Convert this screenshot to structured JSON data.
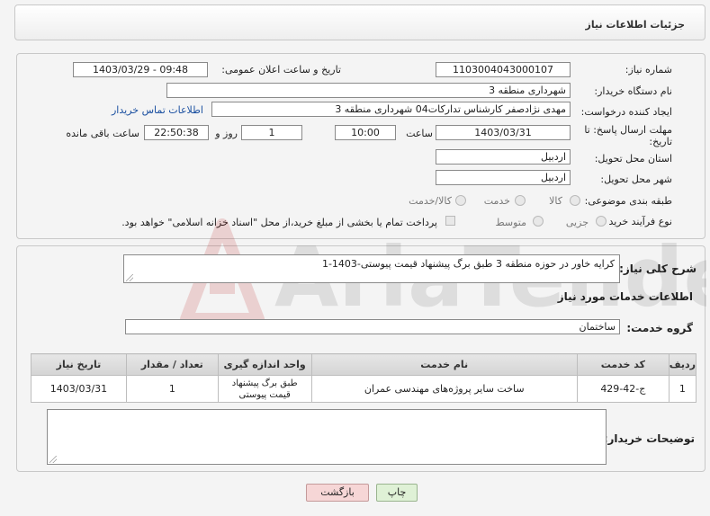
{
  "header": {
    "title": "جزئیات اطلاعات نیاز"
  },
  "form": {
    "need_number_label": "شماره نیاز:",
    "need_number": "1103004043000107",
    "announce_label": "تاریخ و ساعت اعلان عمومی:",
    "announce_value": "1403/03/29 - 09:48",
    "buyer_label": "نام دستگاه خریدار:",
    "buyer_value": "شهرداری منطقه 3",
    "creator_label": "ایجاد کننده درخواست:",
    "creator_value": "مهدی نژادصفر کارشناس تدارکات04 شهرداری منطقه 3",
    "contact_link": "اطلاعات تماس خریدار",
    "deadline_label_line1": "مهلت ارسال پاسخ: تا",
    "deadline_label_line2": "تاریخ:",
    "deadline_date": "1403/03/31",
    "time_label": "ساعت",
    "deadline_time": "10:00",
    "days_value": "1",
    "days_label": "روز و",
    "remaining_time": "22:50:38",
    "remaining_label": "ساعت باقی مانده",
    "province_label": "استان محل تحویل:",
    "province_value": "اردبیل",
    "city_label": "شهر محل تحویل:",
    "city_value": "اردبیل",
    "category_label": "طبقه بندی موضوعی:",
    "category_options": [
      "کالا",
      "خدمت",
      "کالا/خدمت"
    ],
    "process_label": "نوع فرآیند خرید :",
    "process_options": [
      "جزیی",
      "متوسط"
    ],
    "payment_note": "پرداخت تمام یا بخشی از مبلغ خرید،از محل \"اسناد خزانه اسلامی\" خواهد بود."
  },
  "details": {
    "summary_label": "شرح کلی نیاز:",
    "summary_value": "کرایه خاور در حوزه منطقه 3 طبق برگ پیشنهاد قیمت پیوستی-1403-1",
    "services_heading": "اطلاعات خدمات مورد نیاز",
    "service_group_label": "گروه خدمت:",
    "service_group_value": "ساختمان",
    "table": {
      "headers": [
        "ردیف",
        "کد خدمت",
        "نام خدمت",
        "واحد اندازه گیری",
        "تعداد / مقدار",
        "تاریخ نیاز"
      ],
      "rows": [
        [
          "1",
          "ج-42-429",
          "ساخت سایر پروژه‌های مهندسی عمران",
          "طبق برگ پیشنهاد قیمت پیوستی",
          "1",
          "1403/03/31"
        ]
      ]
    },
    "buyer_notes_label": "توضیحات خریدار:"
  },
  "buttons": {
    "print": "چاپ",
    "back": "بازگشت"
  },
  "watermark": {
    "text": "AriaTender.net"
  },
  "colors": {
    "link": "#1a4fa0",
    "back_button": "#f6d6d6",
    "print_button": "#dff1d6"
  }
}
